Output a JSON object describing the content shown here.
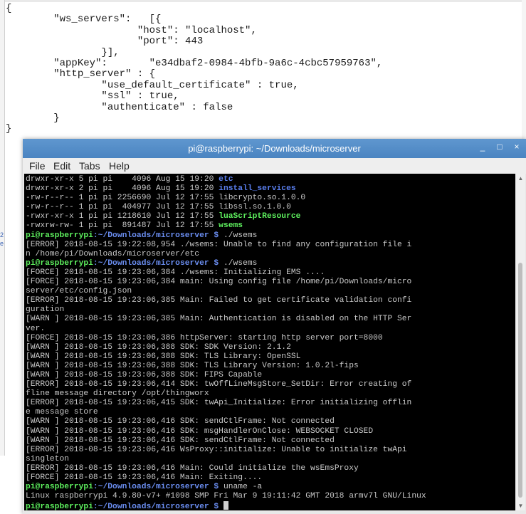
{
  "editor": {
    "lines": [
      "{",
      "        \"ws_servers\":   [{",
      "                      \"host\": \"localhost\",",
      "                      \"port\": 443",
      "                }],",
      "        \"appKey\":       \"e34dbaf2-0984-4bfb-9a6c-4cbc57959763\",",
      "        \"http_server\" : {",
      "                \"use_default_certificate\" : true,",
      "                \"ssl\" : true,",
      "                \"authenticate\" : false",
      "        }",
      "}"
    ],
    "left_marks": [
      "2",
      "e"
    ]
  },
  "terminal_window": {
    "title": "pi@raspberrypi: ~/Downloads/microserver",
    "controls": {
      "minimize": "_",
      "maximize": "□",
      "close": "×"
    },
    "menu": [
      "File",
      "Edit",
      "Tabs",
      "Help"
    ],
    "prompt_user": "pi@raspberrypi",
    "prompt_path": ":~/Downloads/microserver $",
    "listing": [
      {
        "perm": "drwxr-xr-x 5 pi pi    4096 Aug 15 19:20 ",
        "name": "etc",
        "type": "dir"
      },
      {
        "perm": "drwxr-xr-x 2 pi pi    4096 Aug 15 19:20 ",
        "name": "install_services",
        "type": "dir"
      },
      {
        "perm": "-rw-r--r-- 1 pi pi 2256690 Jul 12 17:55 ",
        "name": "libcrypto.so.1.0.0",
        "type": "file"
      },
      {
        "perm": "-rw-r--r-- 1 pi pi  404977 Jul 12 17:55 ",
        "name": "libssl.so.1.0.0",
        "type": "file"
      },
      {
        "perm": "-rwxr-xr-x 1 pi pi 1218610 Jul 12 17:55 ",
        "name": "luaScriptResource",
        "type": "exec"
      },
      {
        "perm": "-rwxrw-rw- 1 pi pi  891487 Jul 12 17:55 ",
        "name": "wsems",
        "type": "exec"
      }
    ],
    "cmd1": " ./wsems",
    "out1": [
      "[ERROR] 2018-08-15 19:22:08,954 ./wsems: Unable to find any configuration file i",
      "n /home/pi/Downloads/microserver/etc"
    ],
    "cmd2": " ./wsems",
    "out2": [
      "[FORCE] 2018-08-15 19:23:06,384 ./wsems: Initializing EMS ....",
      "[FORCE] 2018-08-15 19:23:06,384 main: Using config file /home/pi/Downloads/micro",
      "server/etc/config.json",
      "[ERROR] 2018-08-15 19:23:06,385 Main: Failed to get certificate validation confi",
      "guration",
      "[WARN ] 2018-08-15 19:23:06,385 Main: Authentication is disabled on the HTTP Ser",
      "ver.",
      "[FORCE] 2018-08-15 19:23:06,386 httpServer: starting http server port=8000",
      "[WARN ] 2018-08-15 19:23:06,388 SDK: SDK Version: 2.1.2",
      "[WARN ] 2018-08-15 19:23:06,388 SDK: TLS Library: OpenSSL",
      "[WARN ] 2018-08-15 19:23:06,388 SDK: TLS Library Version: 1.0.2l-fips",
      "[WARN ] 2018-08-15 19:23:06,388 SDK: FIPS Capable",
      "[ERROR] 2018-08-15 19:23:06,414 SDK: twOffLineMsgStore_SetDir: Error creating of",
      "fline message directory /opt/thingworx",
      "[ERROR] 2018-08-15 19:23:06,415 SDK: twApi_Initialize: Error initializing offlin",
      "e message store",
      "[WARN ] 2018-08-15 19:23:06,416 SDK: sendCtlFrame: Not connected",
      "[WARN ] 2018-08-15 19:23:06,416 SDK: msgHandlerOnClose: WEBSOCKET CLOSED",
      "[WARN ] 2018-08-15 19:23:06,416 SDK: sendCtlFrame: Not connected",
      "[ERROR] 2018-08-15 19:23:06,416 WsProxy::initialize: Unable to initialize twApi",
      "singleton",
      "[ERROR] 2018-08-15 19:23:06,416 Main: Could initialize the wsEmsProxy",
      "[FORCE] 2018-08-15 19:23:06,416 Main: Exiting...."
    ],
    "cmd3": " uname -a",
    "out3": [
      "Linux raspberrypi 4.9.80-v7+ #1098 SMP Fri Mar 9 19:11:42 GMT 2018 armv7l GNU/Linux"
    ]
  }
}
